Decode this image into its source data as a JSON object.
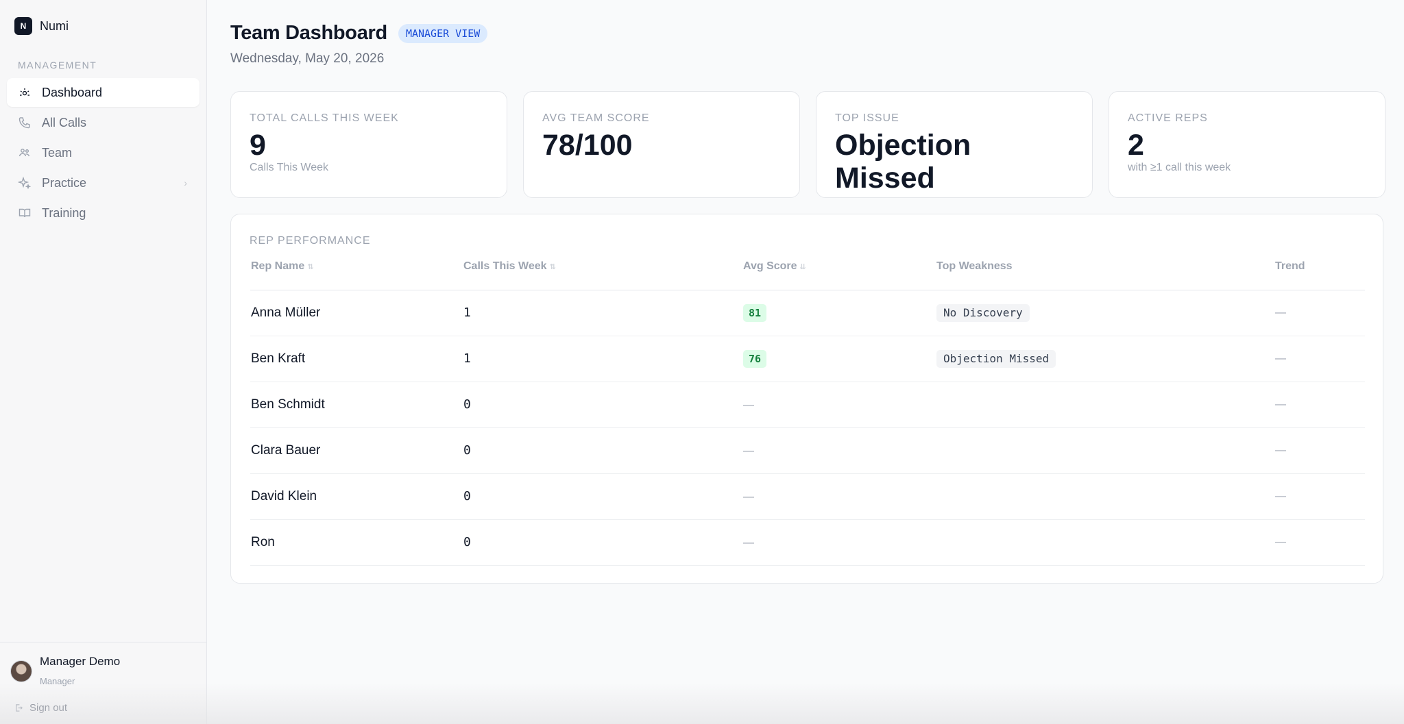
{
  "app": {
    "logo_letter": "N",
    "name": "Numi"
  },
  "sidebar": {
    "section_label": "MANAGEMENT",
    "items": [
      {
        "label": "Dashboard",
        "icon": "dashboard-icon",
        "active": true
      },
      {
        "label": "All Calls",
        "icon": "phone-icon"
      },
      {
        "label": "Team",
        "icon": "team-icon"
      },
      {
        "label": "Practice",
        "icon": "sparkle-icon",
        "has_submenu": true
      },
      {
        "label": "Training",
        "icon": "book-icon"
      }
    ],
    "user": {
      "name": "Manager Demo",
      "role": "Manager"
    },
    "signout_label": "Sign out"
  },
  "header": {
    "title": "Team Dashboard",
    "badge": "MANAGER VIEW",
    "date": "Wednesday, May 20, 2026"
  },
  "cards": [
    {
      "label": "TOTAL CALLS THIS WEEK",
      "value": "9",
      "sub": "Calls This Week"
    },
    {
      "label": "AVG TEAM SCORE",
      "value": "78/100",
      "sub": ""
    },
    {
      "label": "TOP ISSUE",
      "value": "Objection Missed",
      "sub": ""
    },
    {
      "label": "ACTIVE REPS",
      "value": "2",
      "sub": "with ≥1 call this week"
    }
  ],
  "table": {
    "title": "REP PERFORMANCE",
    "columns": [
      "Rep Name",
      "Calls This Week",
      "Avg Score",
      "Top Weakness",
      "Trend"
    ],
    "rows": [
      {
        "name": "Anna Müller",
        "calls": "1",
        "score": "81",
        "weakness": "No Discovery",
        "trend": "—"
      },
      {
        "name": "Ben Kraft",
        "calls": "1",
        "score": "76",
        "weakness": "Objection Missed",
        "trend": "—"
      },
      {
        "name": "Ben Schmidt",
        "calls": "0",
        "score": "—",
        "weakness": "",
        "trend": "—"
      },
      {
        "name": "Clara Bauer",
        "calls": "0",
        "score": "—",
        "weakness": "",
        "trend": "—"
      },
      {
        "name": "David Klein",
        "calls": "0",
        "score": "—",
        "weakness": "",
        "trend": "—"
      },
      {
        "name": "Ron",
        "calls": "0",
        "score": "—",
        "weakness": "",
        "trend": "—"
      }
    ]
  },
  "colors": {
    "score_bg": "#dcfce7",
    "score_text": "#15803d",
    "badge_bg": "#dbeafe",
    "badge_text": "#1d4ed8"
  }
}
